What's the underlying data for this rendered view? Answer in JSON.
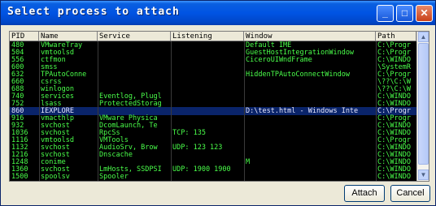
{
  "window": {
    "title": "Select process to attach",
    "minimize": "_",
    "maximize": "□",
    "close": "✕"
  },
  "columns": [
    "PID",
    "Name",
    "Service",
    "Listening",
    "Window",
    "Path"
  ],
  "rows": [
    [
      "480",
      "VMwareTray",
      "",
      "",
      "Default IME",
      "C:\\Progr"
    ],
    [
      "504",
      "vmtoolsd",
      "",
      "",
      "GuestHostIntegrationWindow",
      "C:\\Progr"
    ],
    [
      "556",
      "ctfmon",
      "",
      "",
      "CiceroUIWndFrame",
      "C:\\WINDO"
    ],
    [
      "600",
      "smss",
      "",
      "",
      "",
      "\\SystemR"
    ],
    [
      "632",
      "TPAutoConne",
      "",
      "",
      "HiddenTPAutoConnectWindow",
      "C:\\Progr"
    ],
    [
      "660",
      "csrss",
      "",
      "",
      "",
      "\\??\\C:\\W"
    ],
    [
      "688",
      "winlogon",
      "",
      "",
      "",
      "\\??\\C:\\W"
    ],
    [
      "740",
      "services",
      "Eventlog, Plugl",
      "",
      "",
      "C:\\WINDO"
    ],
    [
      "752",
      "lsass",
      "ProtectedStorag",
      "",
      "",
      "C:\\WINDO"
    ],
    [
      "860",
      "IEXPLORE",
      "",
      "",
      "D:\\test.html - Windows Inte",
      "C:\\Progr"
    ],
    [
      "916",
      "vmacthlp",
      "VMware Physica",
      "",
      "",
      "C:\\Progr"
    ],
    [
      "932",
      "svchost",
      "DcomLaunch, Te",
      "",
      "",
      "C:\\WINDO"
    ],
    [
      "1036",
      "svchost",
      "RpcSs",
      "TCP: 135",
      "",
      "C:\\WINDO"
    ],
    [
      "1116",
      "vmtoolsd",
      "VMTools",
      "",
      "",
      "C:\\Progr"
    ],
    [
      "1132",
      "svchost",
      "AudioSrv, Brow",
      "UDP: 123 123",
      "",
      "C:\\WINDO"
    ],
    [
      "1216",
      "svchost",
      "Dnscache",
      "",
      "",
      "C:\\WINDO"
    ],
    [
      "1248",
      "conime",
      "",
      "",
      "M",
      "C:\\WINDO"
    ],
    [
      "1360",
      "svchost",
      "LmHosts, SSDPSI",
      "UDP: 1900 1900",
      "",
      "C:\\WINDO"
    ],
    [
      "1500",
      "spoolsv",
      "Spooler",
      "",
      "",
      "C:\\WINDO"
    ]
  ],
  "selected_pid": "860",
  "buttons": {
    "attach": "Attach",
    "cancel": "Cancel"
  },
  "scroll": {
    "up": "▲",
    "down": "▼"
  }
}
